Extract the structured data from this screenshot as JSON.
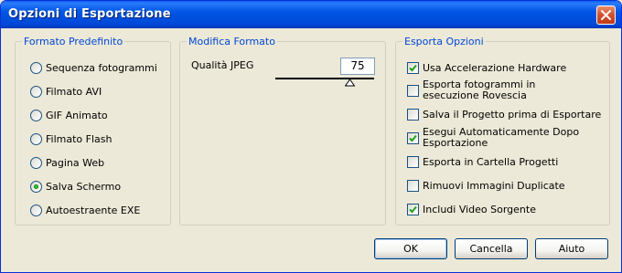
{
  "window": {
    "title": "Opzioni di Esportazione"
  },
  "preset_group": {
    "legend": "Formato Predefinito",
    "options": [
      {
        "label": "Sequenza fotogrammi",
        "selected": false
      },
      {
        "label": "Filmato AVI",
        "selected": false
      },
      {
        "label": "GIF Animato",
        "selected": false
      },
      {
        "label": "Filmato Flash",
        "selected": false
      },
      {
        "label": "Pagina Web",
        "selected": false
      },
      {
        "label": "Salva Schermo",
        "selected": true
      },
      {
        "label": "Autoestraente EXE",
        "selected": false
      }
    ]
  },
  "format_group": {
    "legend": "Modifica Formato",
    "jpeg_label": "Qualità JPEG",
    "jpeg_value": "75",
    "slider_level": 0.75
  },
  "options_group": {
    "legend": "Esporta Opzioni",
    "items": [
      {
        "label": "Usa Accelerazione Hardware",
        "checked": true
      },
      {
        "label": "Esporta fotogrammi in esecuzione Rovescia",
        "checked": false
      },
      {
        "label": "Salva il Progetto prima di Esportare",
        "checked": false
      },
      {
        "label": "Esegui Automaticamente Dopo Esportazione",
        "checked": true
      },
      {
        "label": "Esporta in Cartella Progetti",
        "checked": false
      },
      {
        "label": "Rimuovi Immagini Duplicate",
        "checked": false
      },
      {
        "label": "Includi Video Sorgente",
        "checked": true
      }
    ]
  },
  "buttons": {
    "ok": "OK",
    "cancel": "Cancella",
    "help": "Aiuto"
  }
}
